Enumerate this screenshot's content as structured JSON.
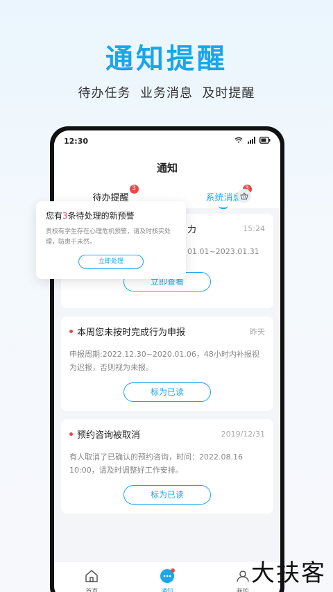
{
  "hero": {
    "title": "通知提醒",
    "subtitle": "待办任务  业务消息  及时提醒"
  },
  "status_bar": {
    "time": "12:30"
  },
  "header": {
    "title": "通知"
  },
  "tabs": [
    {
      "label": "待办提醒",
      "badge": "3"
    },
    {
      "label": "系统消息",
      "badge": "3"
    }
  ],
  "cards": [
    {
      "title": "力",
      "time": "15:24",
      "body": "01.01~2023.01.31",
      "button": "立即查看"
    },
    {
      "title": "本周您未按时完成行为申报",
      "time": "昨天",
      "body": "申报周期:2022.12.30~2020.01.06，48小时内补报视为迟报，否则视为未报。",
      "button": "标为已读"
    },
    {
      "title": "预约咨询被取消",
      "time": "2019/12/31",
      "body": "有人取消了已确认的预约咨询，时间：2022.08.16 10:00，请及时调整好工作安排。",
      "button": "标为已读"
    }
  ],
  "popup": {
    "title_prefix": "您有",
    "title_num": "3",
    "title_suffix": "条待处理的新预警",
    "body": "贵校有学生存在心理危机预警，请及时核实处理，防患于未然。",
    "button": "立即处理"
  },
  "bottom_nav": [
    {
      "label": "首页"
    },
    {
      "label": "通知"
    },
    {
      "label": "我的"
    }
  ],
  "watermark": "大扶客",
  "colors": {
    "accent": "#1aa6e8",
    "badge": "#e94848"
  }
}
